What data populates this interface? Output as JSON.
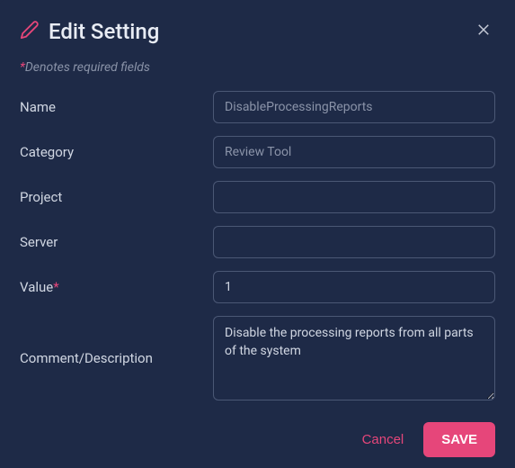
{
  "header": {
    "title": "Edit Setting"
  },
  "requiredNote": {
    "asterisk": "*",
    "text": "Denotes required fields"
  },
  "fields": {
    "name": {
      "label": "Name",
      "value": "DisableProcessingReports"
    },
    "category": {
      "label": "Category",
      "value": "Review Tool"
    },
    "project": {
      "label": "Project",
      "value": ""
    },
    "server": {
      "label": "Server",
      "value": ""
    },
    "value": {
      "label": "Value",
      "asterisk": "*",
      "value": "1"
    },
    "comment": {
      "label": "Comment/Description",
      "value": "Disable the processing reports from all parts of the system"
    }
  },
  "footer": {
    "cancel": "Cancel",
    "save": "SAVE"
  }
}
